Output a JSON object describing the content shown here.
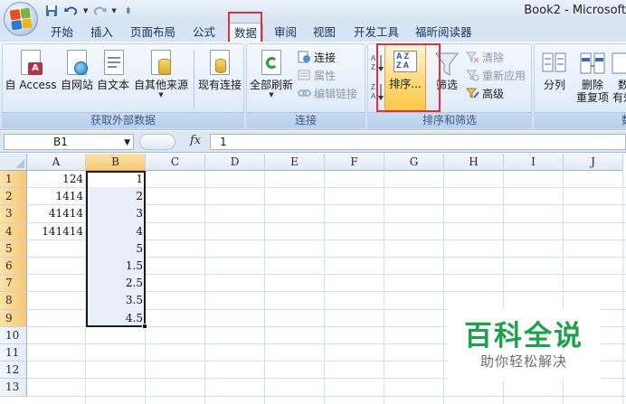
{
  "window": {
    "title": "Book2 - Microsoft"
  },
  "quick_access": {
    "save_icon": "save-icon",
    "undo_icon": "undo-icon",
    "redo_icon": "redo-icon"
  },
  "tabs": [
    {
      "label": "开始"
    },
    {
      "label": "插入"
    },
    {
      "label": "页面布局"
    },
    {
      "label": "公式"
    },
    {
      "label": "数据",
      "active": true
    },
    {
      "label": "审阅"
    },
    {
      "label": "视图"
    },
    {
      "label": "开发工具"
    },
    {
      "label": "福昕阅读器"
    }
  ],
  "ribbon": {
    "external_data": {
      "label": "获取外部数据",
      "access": "自 Access",
      "web": "自网站",
      "text": "自文本",
      "other": "自其他来源",
      "existing": "现有连接"
    },
    "connections": {
      "label": "连接",
      "refresh_all": "全部刷新",
      "connections": "连接",
      "properties": "属性",
      "edit_links": "编辑链接"
    },
    "sort_filter": {
      "label": "排序和筛选",
      "sort": "排序...",
      "filter": "筛选",
      "clear": "清除",
      "reapply": "重新应用",
      "advanced": "高级"
    },
    "data_tools": {
      "label": "数",
      "text_to_columns": "分列",
      "remove_dup_1": "删除",
      "remove_dup_2": "重复项",
      "validation_1": "数",
      "validation_2": "有效"
    }
  },
  "formula_bar": {
    "name_box": "B1",
    "fx_label": "fx",
    "formula": "1"
  },
  "sheet": {
    "columns": [
      "A",
      "B",
      "C",
      "D",
      "E",
      "F",
      "G",
      "H",
      "I",
      "J"
    ],
    "selected_column": "B",
    "rows": [
      "1",
      "2",
      "3",
      "4",
      "5",
      "6",
      "7",
      "8",
      "9",
      "10",
      "11",
      "12",
      "13"
    ],
    "column_a": [
      "124",
      "1414",
      "41414",
      "141414",
      "",
      "",
      "",
      "",
      ""
    ],
    "column_b": [
      "1",
      "2",
      "3",
      "4",
      "5",
      "1.5",
      "2.5",
      "3.5",
      "4.5"
    ]
  },
  "watermark": {
    "title": "百科全说",
    "subtitle": "助你轻松解决"
  },
  "colors": {
    "highlight": "#e0303a",
    "watermark_green": "#1aa34a",
    "selection_header": "#f8c870"
  }
}
